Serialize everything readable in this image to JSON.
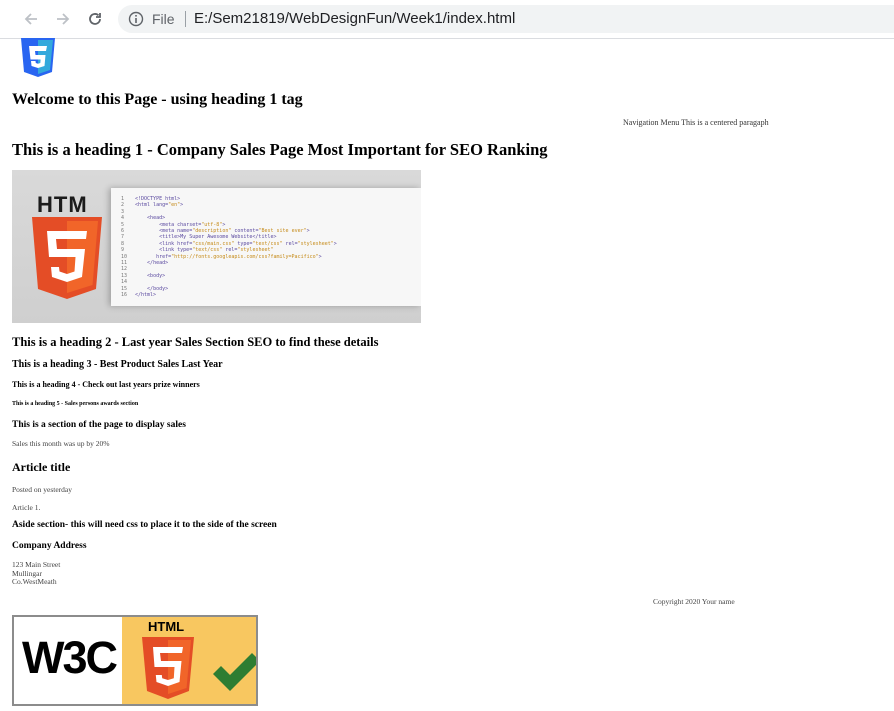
{
  "browser": {
    "scheme_label": "File",
    "url": "E:/Sem21819/WebDesignFun/Week1/index.html"
  },
  "page": {
    "h1_welcome": "Welcome to this Page - using heading 1 tag",
    "nav_line": "Navigation Menu This is a centered paragaph",
    "h1_company": "This is a heading 1 - Company Sales Page Most Important for SEO Ranking",
    "code_image": {
      "htm_text": "HTM"
    },
    "h2": "This is a heading 2 - Last year Sales Section SEO to find these details",
    "h3": "This is a heading 3 - Best Product Sales Last Year",
    "h4": "This is a heading 4 - Check out last years prize winners",
    "h5": "This is a heading 5 - Sales persons awards section",
    "section_heading": "This is a section of the page to display sales",
    "sales_text": "Sales this month was up by 20%",
    "article_title": "Article title",
    "posted": "Posted on yesterday",
    "article_body": "Article 1.",
    "aside_heading": "Aside section- this will need css to place it to the side of the screen",
    "address_heading": "Company Address",
    "address_lines": [
      "123 Main Street",
      "Mullingar",
      "Co.WestMeath"
    ],
    "copyright": "Copyright 2020 Your name",
    "badge": {
      "w3c": "W3C",
      "html_label": "HTML"
    }
  },
  "colors": {
    "html5_orange": "#e44d26",
    "html5_light_orange": "#f16529",
    "css3_blue": "#2965f1",
    "badge_yellow": "#f8c760",
    "check_green": "#2e7d32"
  }
}
